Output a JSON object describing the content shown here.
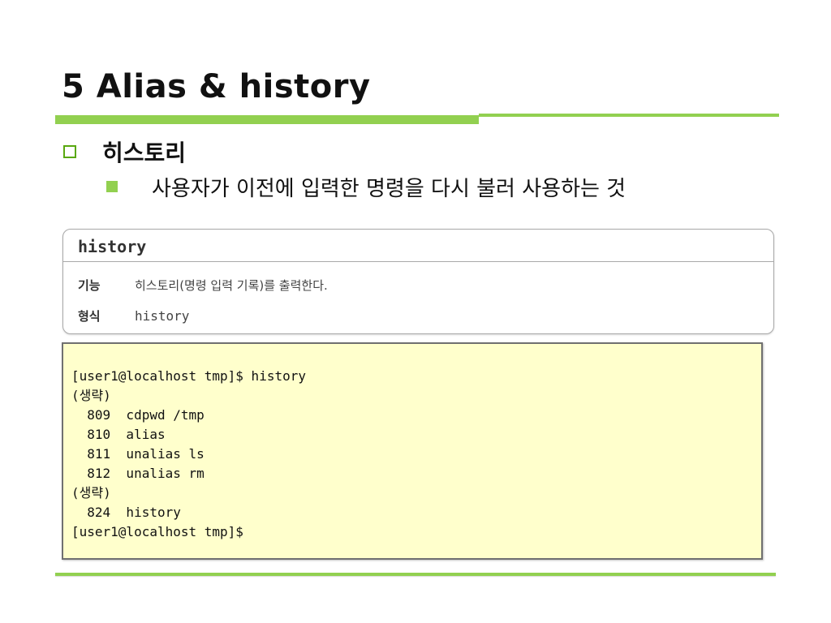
{
  "slide": {
    "title": "5 Alias & history",
    "bullet_1": "히스토리",
    "bullet_2": "사용자가 이전에 입력한 명령을 다시 불러 사용하는 것"
  },
  "command_card": {
    "name": "history",
    "rows": [
      {
        "label": "기능",
        "value": "히스토리(명령 입력 기록)를 출력한다."
      },
      {
        "label": "형식",
        "value": "history"
      }
    ]
  },
  "terminal": {
    "lines": [
      "[user1@localhost tmp]$ history",
      "(생략)",
      "  809  cdpwd /tmp",
      "  810  alias",
      "  811  unalias ls",
      "  812  unalias rm",
      "(생략)",
      "  824  history",
      "[user1@localhost tmp]$"
    ]
  },
  "colors": {
    "accent_green": "#92d050",
    "terminal_bg": "#ffffcc"
  }
}
